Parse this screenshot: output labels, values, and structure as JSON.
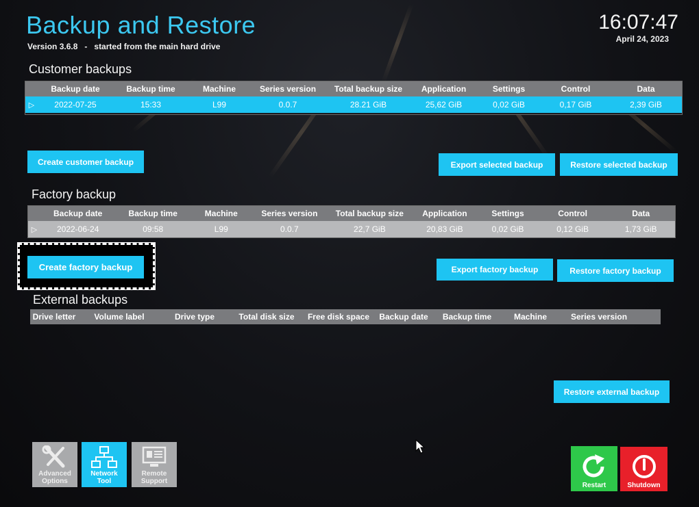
{
  "app": {
    "title": "Backup and Restore",
    "version": "Version 3.6.8",
    "version_separator": "-",
    "started_from": "started from the main hard drive",
    "time": "16:07:47",
    "date": "April 24, 2023"
  },
  "customer": {
    "title": "Customer backups",
    "columns": [
      "Backup date",
      "Backup time",
      "Machine",
      "Series version",
      "Total backup size",
      "Application",
      "Settings",
      "Control",
      "Data"
    ],
    "rows": [
      {
        "cells": [
          "2022-07-25",
          "15:33",
          "L99",
          "0.0.7",
          "28.21 GiB",
          "25,62 GiB",
          "0,02 GiB",
          "0,17 GiB",
          "2,39 GiB"
        ]
      }
    ],
    "create_button": "Create customer backup",
    "export_button": "Export selected backup",
    "restore_button": "Restore selected backup"
  },
  "factory": {
    "title": "Factory backup",
    "columns": [
      "Backup date",
      "Backup time",
      "Machine",
      "Series version",
      "Total backup size",
      "Application",
      "Settings",
      "Control",
      "Data"
    ],
    "rows": [
      {
        "cells": [
          "2022-06-24",
          "09:58",
          "L99",
          "0.0.7",
          "22,7 GiB",
          "20,83 GiB",
          "0,02 GiB",
          "0,12 GiB",
          "1,73 GiB"
        ]
      }
    ],
    "create_button": "Create factory backup",
    "export_button": "Export factory backup",
    "restore_button": "Restore factory backup"
  },
  "external": {
    "title": "External backups",
    "columns": [
      "Drive letter",
      "Volume label",
      "Drive type",
      "Total disk size",
      "Free disk space",
      "Backup date",
      "Backup time",
      "Machine",
      "Series version"
    ],
    "restore_button": "Restore external backup"
  },
  "tools": {
    "advanced": "Advanced\nOptions",
    "network": "Network\nTool",
    "remote": "Remote\nSupport",
    "restart": "Restart",
    "shutdown": "Shutdown"
  },
  "colors": {
    "accent": "#1ec4f2",
    "title": "#3cc8f0",
    "header_gray": "#7a7b7e",
    "restart_green": "#2ec84a",
    "shutdown_red": "#e8202a",
    "tile_gray": "#a9aaac"
  },
  "icons": {
    "row_indicator": "triangle-right-icon",
    "advanced": "wrench-screwdriver-icon",
    "network": "network-tree-icon",
    "remote": "remote-monitor-icon",
    "restart": "restart-arrow-icon",
    "shutdown": "power-icon"
  }
}
